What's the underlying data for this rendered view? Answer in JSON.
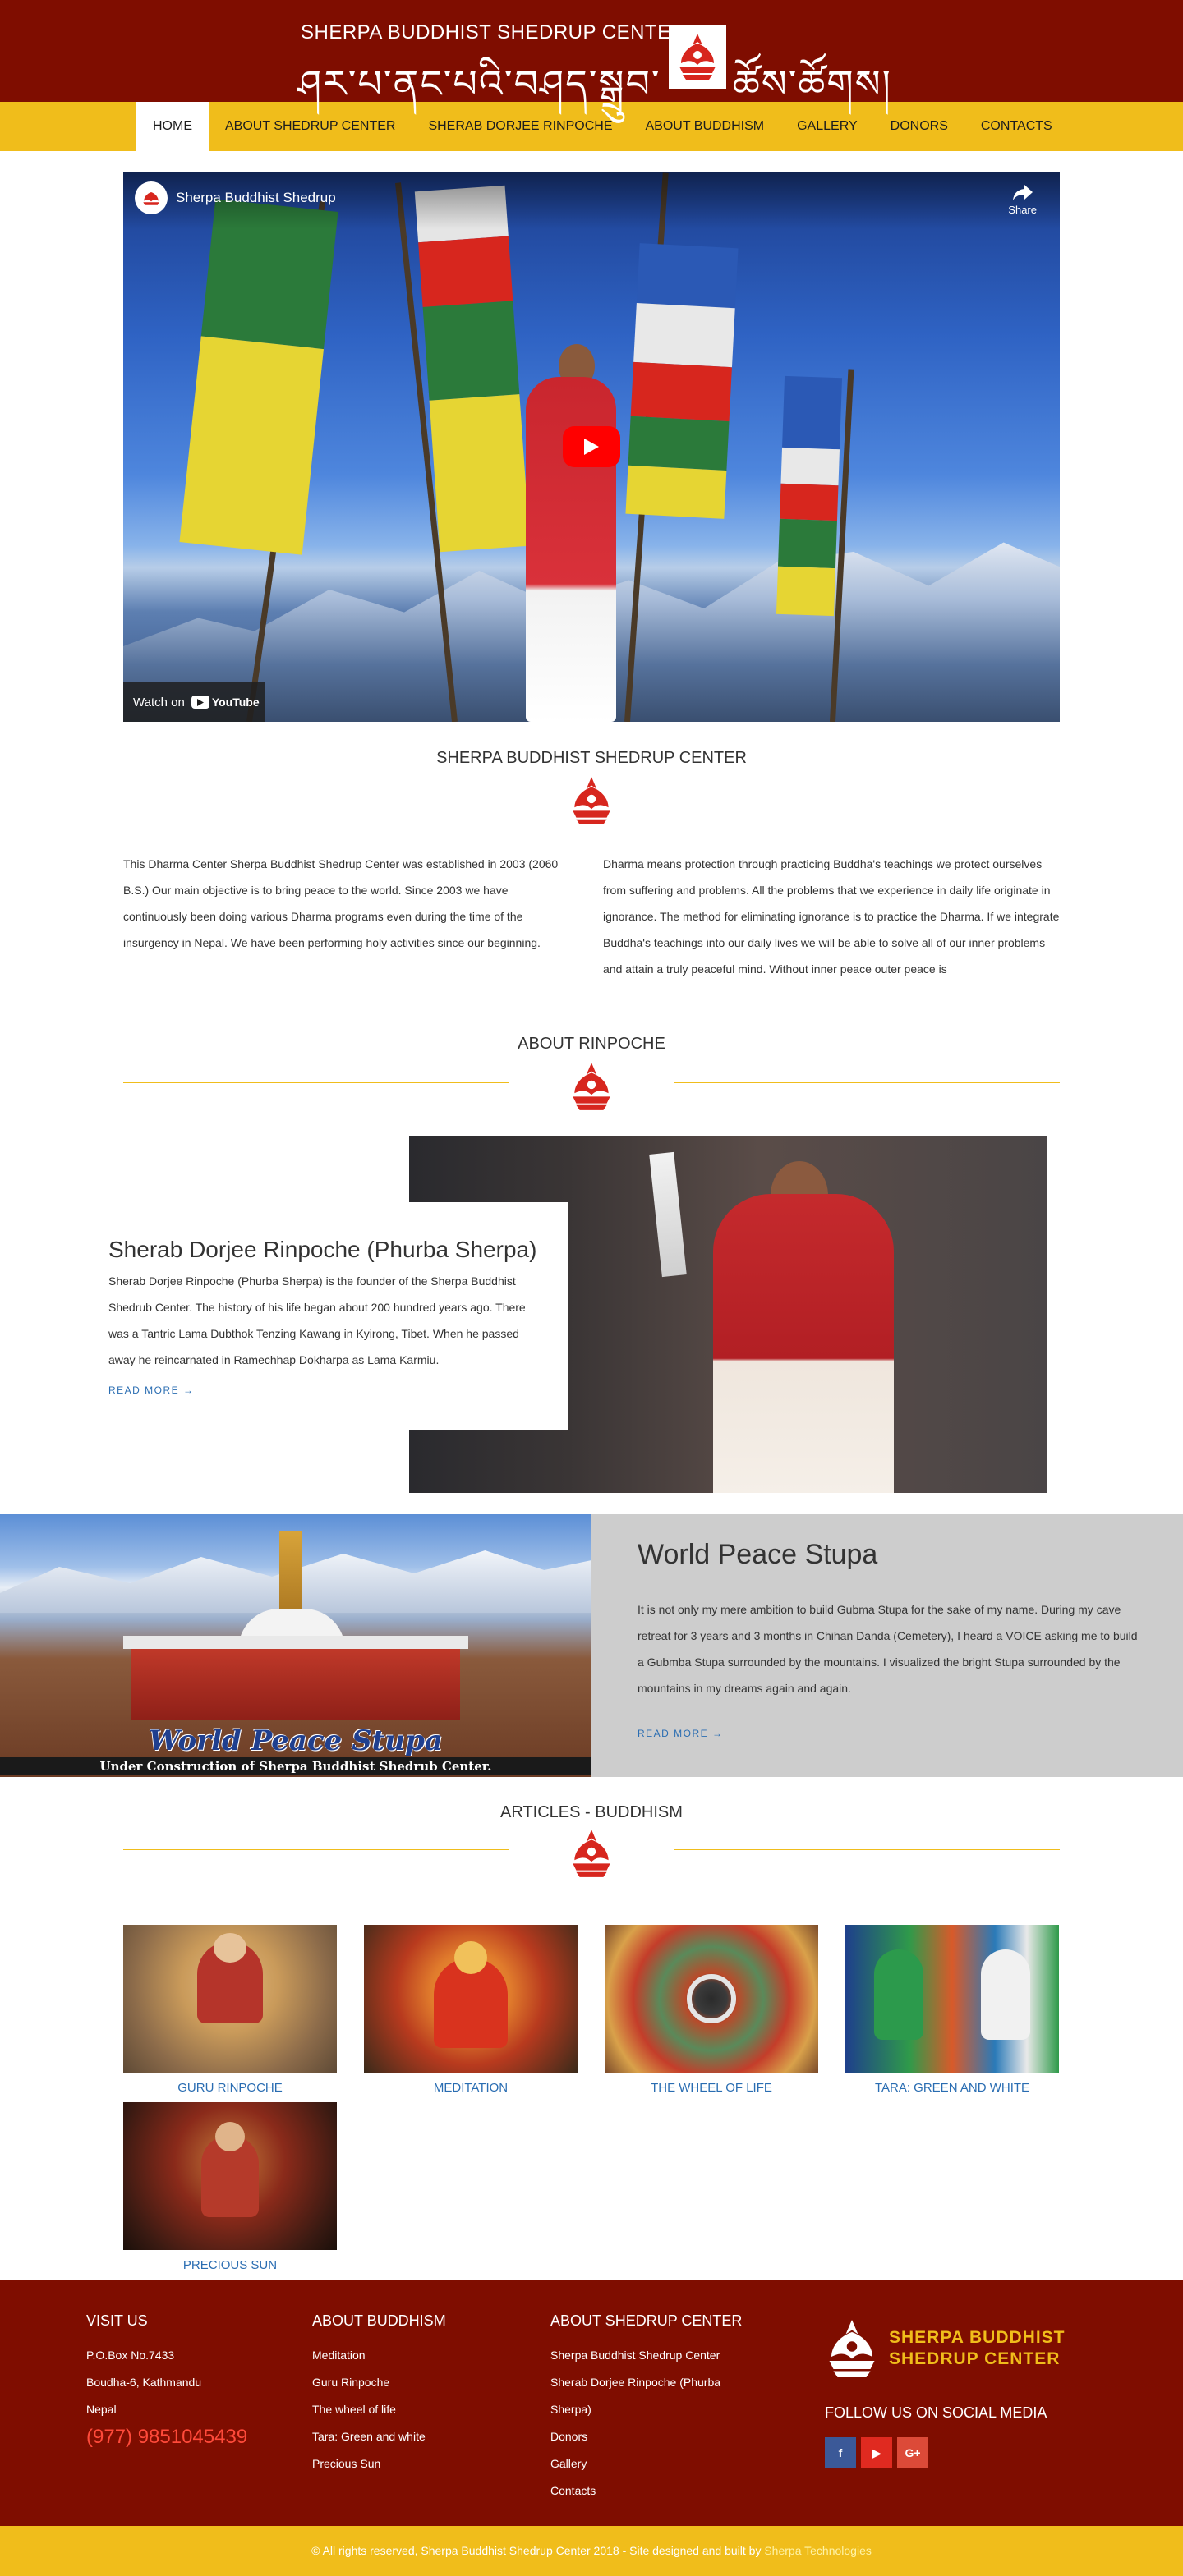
{
  "header": {
    "title_en": "SHERPA BUDDHIST SHEDRUP CENTER",
    "title_tibetan": "ཤར་པ་ནང་པའི་བཤད་སྒྲུབ་",
    "title_tibetan_2": "ཚོས་ཚོགས།"
  },
  "nav": {
    "items": [
      {
        "label": "HOME"
      },
      {
        "label": "ABOUT SHEDRUP CENTER"
      },
      {
        "label": "SHERAB DORJEE RINPOCHE"
      },
      {
        "label": "ABOUT BUDDHISM"
      },
      {
        "label": "GALLERY"
      },
      {
        "label": "DONORS"
      },
      {
        "label": "CONTACTS"
      }
    ]
  },
  "video": {
    "title": "Sherpa Buddhist Shedrup",
    "share_label": "Share",
    "watch_on": "Watch on",
    "youtube": "YouTube"
  },
  "intro": {
    "title": "SHERPA BUDDHIST SHEDRUP CENTER",
    "left_text": "This Dharma Center Sherpa Buddhist Shedrup Center was established in 2003 (2060 B.S.) Our main objective is to bring peace to the world. Since 2003 we have continuously been doing various Dharma programs even during the time of the insurgency in Nepal. We have been performing holy activities since our beginning.",
    "right_text": "Dharma means protection through practicing Buddha's teachings we protect ourselves from suffering and problems. All the problems that we experience in daily life originate in ignorance. The method for eliminating ignorance is to practice the Dharma. If we integrate Buddha's teachings into our daily lives we will be able to solve all of our inner problems and attain a truly peaceful mind. Without inner peace outer peace is"
  },
  "about_rinpoche": {
    "section_title": "ABOUT RINPOCHE",
    "name": "Sherab Dorjee Rinpoche (Phurba Sherpa)",
    "text": "Sherab Dorjee Rinpoche (Phurba Sherpa) is the founder of the Sherpa Buddhist Shedrub Center. The history of his life began about 200 hundred years ago. There was a Tantric Lama Dubthok Tenzing Kawang in Kyirong, Tibet. When he passed away he reincarnated in Ramechhap Dokharpa as Lama Karmiu.",
    "read_more": "READ MORE →"
  },
  "world_peace": {
    "image_caption_1": "World Peace Stupa",
    "image_caption_2": "Under Construction of Sherpa Buddhist Shedrub Center.",
    "title": "World Peace Stupa",
    "text": "It is not only my mere ambition to build Gubma Stupa for the sake of my name.  During my cave retreat for 3 years and 3 months in Chihan Danda (Cemetery), I heard a VOICE asking me to build a Gubmba Stupa surrounded by the mountains.  I visualized the bright Stupa surrounded by the mountains in my dreams again and again.",
    "read_more": "READ MORE →"
  },
  "articles": {
    "title": "ARTICLES - BUDDHISM",
    "items": [
      {
        "label": "GURU RINPOCHE"
      },
      {
        "label": "MEDITATION"
      },
      {
        "label": "THE WHEEL OF LIFE"
      },
      {
        "label": "TARA: GREEN AND WHITE"
      },
      {
        "label": "PRECIOUS SUN"
      }
    ]
  },
  "footer": {
    "visit_title": "VISIT US",
    "address": [
      "P.O.Box No.7433",
      "Boudha-6, Kathmandu",
      "Nepal"
    ],
    "phone": "(977) 9851045439",
    "buddhism_title": "ABOUT BUDDHISM",
    "buddhism_links": [
      "Meditation",
      "Guru Rinpoche",
      "The wheel of life",
      "Tara: Green and white",
      "Precious Sun"
    ],
    "shedrup_title": "ABOUT SHEDRUP CENTER",
    "shedrup_links": [
      "Sherpa Buddhist Shedrup Center",
      "Sherab Dorjee Rinpoche (Phurba",
      "Sherpa)",
      "Donors",
      "Gallery",
      "Contacts"
    ],
    "logo_line1": "SHERPA BUDDHIST",
    "logo_line2": "SHEDRUP CENTER",
    "social_title": "FOLLOW US ON SOCIAL MEDIA",
    "social": [
      {
        "glyph": "f",
        "color": "#3b5998"
      },
      {
        "glyph": "▶",
        "color": "#e02a20"
      },
      {
        "glyph": "G+",
        "color": "#dc4a38"
      }
    ]
  },
  "bottom_bar": {
    "text": "© All rights reserved, Sherpa Buddhist Shedrup Center 2018 - Site designed and built by ",
    "link": "Sherpa Technologies"
  },
  "colors": {
    "maroon": "#7f0d00",
    "gold": "#f0bd1b",
    "link_blue": "#2a6db2",
    "phone_red": "#ff4a3a"
  }
}
